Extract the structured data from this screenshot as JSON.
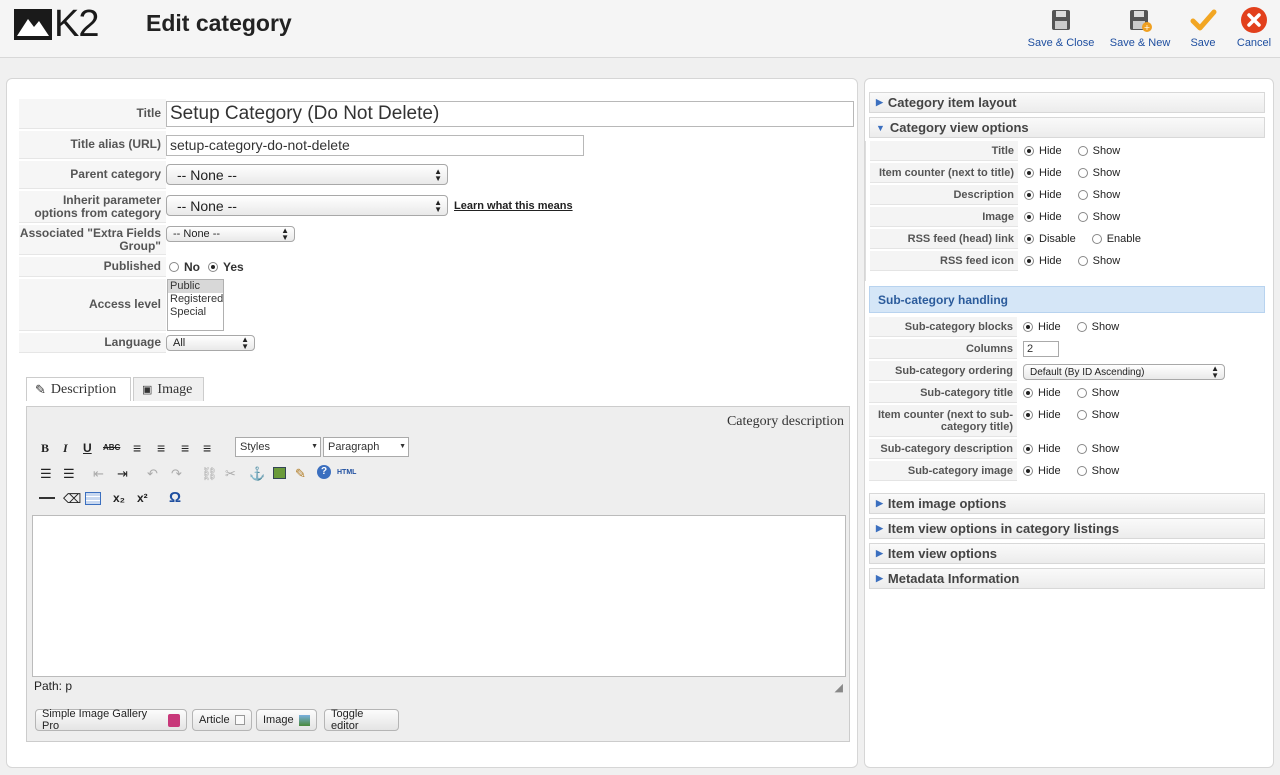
{
  "header": {
    "title": "Edit category",
    "logo_text": "K2",
    "buttons": [
      {
        "label": "Save & Close",
        "icon": "save-icon"
      },
      {
        "label": "Save & New",
        "icon": "save-new-icon"
      },
      {
        "label": "Save",
        "icon": "checkmark-icon"
      },
      {
        "label": "Cancel",
        "icon": "cancel-icon"
      }
    ]
  },
  "form": {
    "title_label": "Title",
    "title_value": "Setup Category (Do Not Delete)",
    "alias_label": "Title alias (URL)",
    "alias_value": "setup-category-do-not-delete",
    "parent_label": "Parent category",
    "parent_value": "-- None --",
    "inherit_label": "Inherit parameter options from category",
    "inherit_value": "-- None --",
    "inherit_link": "Learn what this means",
    "extra_fields_label": "Associated \"Extra Fields Group\"",
    "extra_fields_value": "-- None --",
    "published_label": "Published",
    "published_no": "No",
    "published_yes": "Yes",
    "access_label": "Access level",
    "access_options": [
      "Public",
      "Registered",
      "Special"
    ],
    "language_label": "Language",
    "language_value": "All"
  },
  "tabs": {
    "description": "Description",
    "image": "Image"
  },
  "editor": {
    "header": "Category description",
    "styles": "Styles",
    "format": "Paragraph",
    "path": "Path: p",
    "buttons": [
      "Simple Image Gallery Pro",
      "Article",
      "Image",
      "Toggle editor"
    ]
  },
  "right": {
    "sections": {
      "item_layout": "Category item layout",
      "view_options": "Category view options",
      "item_image": "Item image options",
      "item_view_listing": "Item view options in category listings",
      "item_view": "Item view options",
      "metadata": "Metadata Information"
    },
    "view_rows": [
      {
        "label": "Title",
        "a": "Hide",
        "b": "Show"
      },
      {
        "label": "Item counter (next to title)",
        "a": "Hide",
        "b": "Show"
      },
      {
        "label": "Description",
        "a": "Hide",
        "b": "Show"
      },
      {
        "label": "Image",
        "a": "Hide",
        "b": "Show"
      },
      {
        "label": "RSS feed (head) link",
        "a": "Disable",
        "b": "Enable"
      },
      {
        "label": "RSS feed icon",
        "a": "Hide",
        "b": "Show"
      }
    ],
    "subcat_head": "Sub-category handling",
    "subcat_blocks": {
      "label": "Sub-category blocks",
      "a": "Hide",
      "b": "Show"
    },
    "columns_label": "Columns",
    "columns_value": "2",
    "ordering_label": "Sub-category ordering",
    "ordering_value": "Default (By ID Ascending)",
    "subcat_rows": [
      {
        "label": "Sub-category title",
        "a": "Hide",
        "b": "Show"
      },
      {
        "label": "Item counter (next to sub-category title)",
        "a": "Hide",
        "b": "Show"
      },
      {
        "label": "Sub-category description",
        "a": "Hide",
        "b": "Show"
      },
      {
        "label": "Sub-category image",
        "a": "Hide",
        "b": "Show"
      }
    ]
  }
}
